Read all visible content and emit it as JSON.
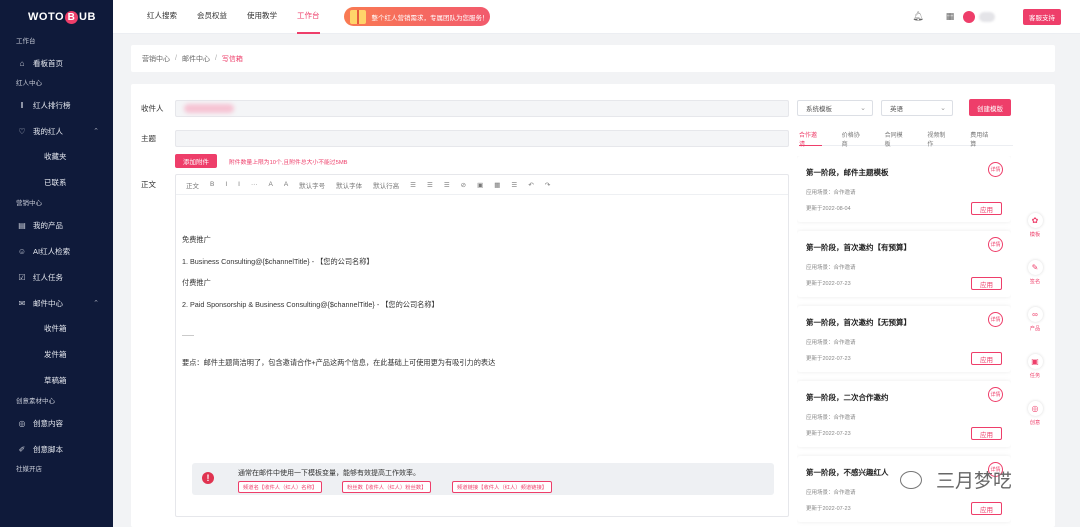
{
  "colors": {
    "accent": "#ee3e6a",
    "sidebar_bg": "#0f1a3a"
  },
  "brand": {
    "left": "WOTO",
    "mid": "B",
    "right": "UB"
  },
  "sidebar": [
    {
      "type": "section",
      "label": "工作台"
    },
    {
      "type": "item",
      "icon": "home-icon",
      "label": "看板首页"
    },
    {
      "type": "section",
      "label": "红人中心"
    },
    {
      "type": "item",
      "icon": "bar-chart-icon",
      "label": "红人排行榜"
    },
    {
      "type": "item",
      "icon": "heart-icon",
      "label": "我的红人",
      "expand": true
    },
    {
      "type": "sub",
      "label": "收藏夹"
    },
    {
      "type": "sub",
      "label": "已联系"
    },
    {
      "type": "section",
      "label": "营销中心"
    },
    {
      "type": "item",
      "icon": "product-icon",
      "label": "我的产品"
    },
    {
      "type": "item",
      "icon": "user-search-icon",
      "label": "AI红人检索"
    },
    {
      "type": "item",
      "icon": "checkbox-icon",
      "label": "红人任务"
    },
    {
      "type": "item",
      "icon": "mail-icon",
      "label": "邮件中心",
      "expand": true
    },
    {
      "type": "sub",
      "label": "收件箱"
    },
    {
      "type": "sub",
      "label": "发件箱"
    },
    {
      "type": "sub",
      "label": "草稿箱"
    },
    {
      "type": "section",
      "label": "创意素材中心"
    },
    {
      "type": "item",
      "icon": "creative-icon",
      "label": "创意内容"
    },
    {
      "type": "item",
      "icon": "script-icon",
      "label": "创意脚本"
    },
    {
      "type": "section",
      "label": "社媒开店"
    }
  ],
  "topnav": {
    "items": [
      "红人搜索",
      "会员权益",
      "使用教学",
      "工作台"
    ],
    "active_index": 3,
    "banner": "整个红人营销需求，专属团队为您服务！",
    "service_button": "客服支持"
  },
  "breadcrumb": [
    "营销中心",
    "邮件中心",
    "写信箱"
  ],
  "compose": {
    "recipient_label": "收件人",
    "subject_label": "主题",
    "attach_button": "添加附件",
    "attach_hint": "附件数量上限为10个,且附件总大小不能过5MB",
    "body_label": "正文",
    "toolbar": [
      "正文",
      "B",
      "I",
      "I",
      "···",
      "A",
      "A",
      "默认字号",
      "默认字体",
      "默认行高",
      "☰",
      "☰",
      "☰",
      "⊘",
      "▣",
      "▦",
      "☰",
      "↶",
      "↷"
    ],
    "body_lines": [
      "免费推广",
      "1. Business Consulting@{$channelTitle} - 【您的公司名称】",
      "付费推广",
      "2. Paid Sponsorship & Business Consulting@{$channelTitle} - 【您的公司名称】",
      "......",
      "要点：邮件主题简洁明了，包含邀请合作+产品这两个信息，在此基础上可使用更为有吸引力的表达"
    ],
    "notice": "通常在邮件中使用一下模板变量，能够有效提高工作效率。",
    "variables": [
      "频道名【收件人（红人）名称】",
      "粉丝数【收件人（红人）粉丝数】",
      "频道链接【收件人（红人）频道链接】"
    ]
  },
  "templates": {
    "type_select": "系统模板",
    "lang_select": "英语",
    "create_button": "创建模版",
    "tabs": [
      "合作邀请",
      "价格协商",
      "合同模板",
      "视频制作",
      "费用结算"
    ],
    "active_tab": 0,
    "cards": [
      {
        "title": "第一阶段，邮件主题模板",
        "badge": "详情",
        "scene": "应用场景：合作邀请",
        "date": "更新于2022-08-04",
        "apply": "应用"
      },
      {
        "title": "第一阶段，首次邀约【有预算】",
        "badge": "详情",
        "scene": "应用场景：合作邀请",
        "date": "更新于2022-07-23",
        "apply": "应用"
      },
      {
        "title": "第一阶段，首次邀约【无预算】",
        "badge": "详情",
        "scene": "应用场景：合作邀请",
        "date": "更新于2022-07-23",
        "apply": "应用"
      },
      {
        "title": "第一阶段，二次合作邀约",
        "badge": "详情",
        "scene": "应用场景：合作邀请",
        "date": "更新于2022-07-23",
        "apply": "应用"
      },
      {
        "title": "第一阶段，不感兴趣红人",
        "badge": "详情",
        "scene": "应用场景：合作邀请",
        "date": "更新于2022-07-23",
        "apply": "应用"
      }
    ]
  },
  "float_tools": [
    {
      "icon": "template-icon",
      "label": "模板"
    },
    {
      "icon": "signature-icon",
      "label": "签名"
    },
    {
      "icon": "link-icon",
      "label": "产品"
    },
    {
      "icon": "task-icon",
      "label": "任务"
    },
    {
      "icon": "creative-icon",
      "label": "创意"
    }
  ],
  "watermark": "三月梦呓"
}
